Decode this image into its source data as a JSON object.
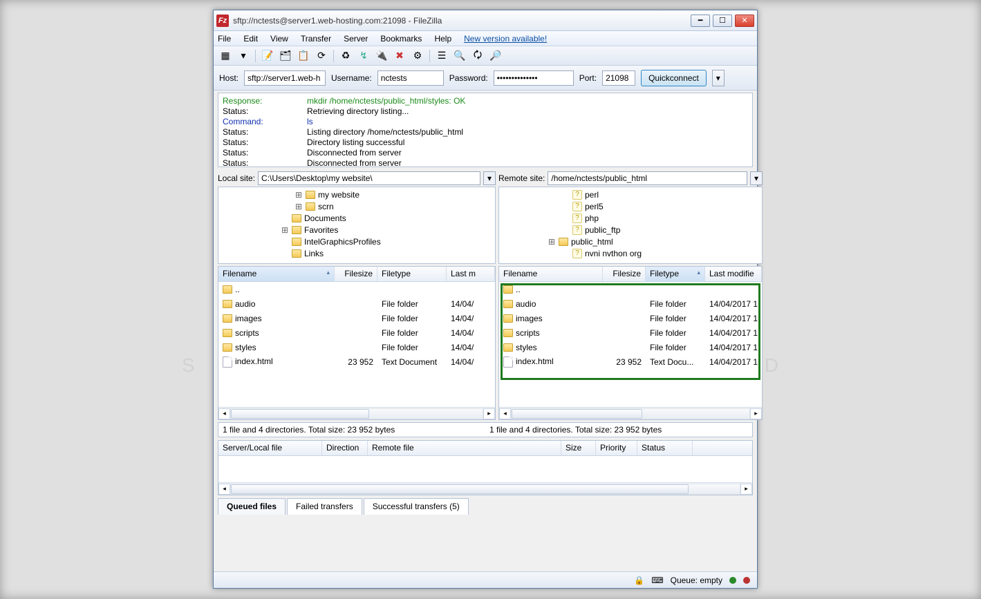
{
  "title": "sftp://nctests@server1.web-hosting.com:21098 - FileZilla",
  "menu": [
    "File",
    "Edit",
    "View",
    "Transfer",
    "Server",
    "Bookmarks",
    "Help"
  ],
  "menu_link": "New version available!",
  "conn": {
    "host_label": "Host:",
    "host": "sftp://server1.web-h",
    "user_label": "Username:",
    "user": "nctests",
    "pass_label": "Password:",
    "pass": "••••••••••••••",
    "port_label": "Port:",
    "port": "21098",
    "quick": "Quickconnect"
  },
  "log": [
    {
      "lbl": "Response:",
      "cls": "green",
      "txt": "mkdir /home/nctests/public_html/styles: OK"
    },
    {
      "lbl": "Status:",
      "cls": "",
      "txt": "Retrieving directory listing..."
    },
    {
      "lbl": "Command:",
      "cls": "blue",
      "txt": "ls"
    },
    {
      "lbl": "Status:",
      "cls": "",
      "txt": "Listing directory /home/nctests/public_html"
    },
    {
      "lbl": "Status:",
      "cls": "",
      "txt": "Directory listing successful"
    },
    {
      "lbl": "Status:",
      "cls": "",
      "txt": "Disconnected from server"
    },
    {
      "lbl": "Status:",
      "cls": "",
      "txt": "Disconnected from server"
    }
  ],
  "local": {
    "label": "Local site:",
    "path": "C:\\Users\\Desktop\\my website\\",
    "tree": [
      {
        "tw": "⊞",
        "ico": "folder",
        "name": "my website",
        "pad": 0
      },
      {
        "tw": "⊞",
        "ico": "folder",
        "name": "scrn",
        "pad": 0
      },
      {
        "tw": "",
        "ico": "folder",
        "name": "Documents",
        "pad": -20
      },
      {
        "tw": "⊞",
        "ico": "fav",
        "name": "Favorites",
        "pad": -20
      },
      {
        "tw": "",
        "ico": "folder",
        "name": "IntelGraphicsProfiles",
        "pad": -20
      },
      {
        "tw": "",
        "ico": "folder",
        "name": "Links",
        "pad": -20
      }
    ],
    "cols": [
      "Filename",
      "Filesize",
      "Filetype",
      "Last m"
    ],
    "rows": [
      {
        "ico": "folder",
        "name": "..",
        "size": "",
        "type": "",
        "mod": ""
      },
      {
        "ico": "folder",
        "name": "audio",
        "size": "",
        "type": "File folder",
        "mod": "14/04/"
      },
      {
        "ico": "folder",
        "name": "images",
        "size": "",
        "type": "File folder",
        "mod": "14/04/"
      },
      {
        "ico": "folder",
        "name": "scripts",
        "size": "",
        "type": "File folder",
        "mod": "14/04/"
      },
      {
        "ico": "folder",
        "name": "styles",
        "size": "",
        "type": "File folder",
        "mod": "14/04/"
      },
      {
        "ico": "file",
        "name": "index.html",
        "size": "23 952",
        "type": "Text Document",
        "mod": "14/04/"
      }
    ],
    "status": "1 file and 4 directories. Total size: 23 952 bytes"
  },
  "remote": {
    "label": "Remote site:",
    "path": "/home/nctests/public_html",
    "tree": [
      {
        "tw": "",
        "ico": "q",
        "name": "perl",
        "pad": 0
      },
      {
        "tw": "",
        "ico": "q",
        "name": "perl5",
        "pad": 0
      },
      {
        "tw": "",
        "ico": "q",
        "name": "php",
        "pad": 0
      },
      {
        "tw": "",
        "ico": "q",
        "name": "public_ftp",
        "pad": 0
      },
      {
        "tw": "⊞",
        "ico": "folder",
        "name": "public_html",
        "pad": -20
      },
      {
        "tw": "",
        "ico": "q",
        "name": "nvni nvthon org",
        "pad": 0
      }
    ],
    "cols": [
      "Filename",
      "Filesize",
      "Filetype",
      "Last modifie"
    ],
    "rows": [
      {
        "ico": "folder",
        "name": "..",
        "size": "",
        "type": "",
        "mod": ""
      },
      {
        "ico": "folder",
        "name": "audio",
        "size": "",
        "type": "File folder",
        "mod": "14/04/2017 1"
      },
      {
        "ico": "folder",
        "name": "images",
        "size": "",
        "type": "File folder",
        "mod": "14/04/2017 1"
      },
      {
        "ico": "folder",
        "name": "scripts",
        "size": "",
        "type": "File folder",
        "mod": "14/04/2017 1"
      },
      {
        "ico": "folder",
        "name": "styles",
        "size": "",
        "type": "File folder",
        "mod": "14/04/2017 1"
      },
      {
        "ico": "file",
        "name": "index.html",
        "size": "23 952",
        "type": "Text Docu...",
        "mod": "14/04/2017 1"
      }
    ],
    "status": "1 file and 4 directories. Total size: 23 952 bytes"
  },
  "queue_cols": [
    "Server/Local file",
    "Direction",
    "Remote file",
    "Size",
    "Priority",
    "Status"
  ],
  "tabs": {
    "queued": "Queued files",
    "failed": "Failed transfers",
    "success": "Successful transfers (5)"
  },
  "bottom": {
    "queue": "Queue: empty"
  }
}
